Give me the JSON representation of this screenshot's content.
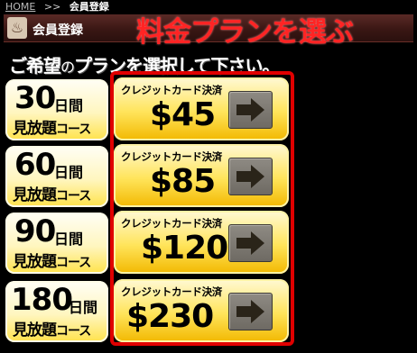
{
  "breadcrumb": {
    "home": "HOME",
    "separator": ">>",
    "current": "会員登録"
  },
  "header": {
    "icon": "hot-spring-icon",
    "title": "会員登録"
  },
  "annotation": "料金プランを選ぶ",
  "subtitle": {
    "part1": "ご希望",
    "part2": "の",
    "part3": "プランを選択して下さい。"
  },
  "plans": [
    {
      "days": "30",
      "unit": "日間",
      "label_kanji": "見放題",
      "label_kana": "コース",
      "method": "クレジットカード決済",
      "price": "$45"
    },
    {
      "days": "60",
      "unit": "日間",
      "label_kanji": "見放題",
      "label_kana": "コース",
      "method": "クレジットカード決済",
      "price": "$85"
    },
    {
      "days": "90",
      "unit": "日間",
      "label_kanji": "見放題",
      "label_kana": "コース",
      "method": "クレジットカード決済",
      "price": "$120"
    },
    {
      "days": "180",
      "unit": "日間",
      "label_kanji": "見放題",
      "label_kana": "コース",
      "method": "クレジットカード決済",
      "price": "$230"
    }
  ],
  "colors": {
    "annotation": "#ff2424",
    "frame": "#e00000",
    "header": "#3a1714"
  }
}
